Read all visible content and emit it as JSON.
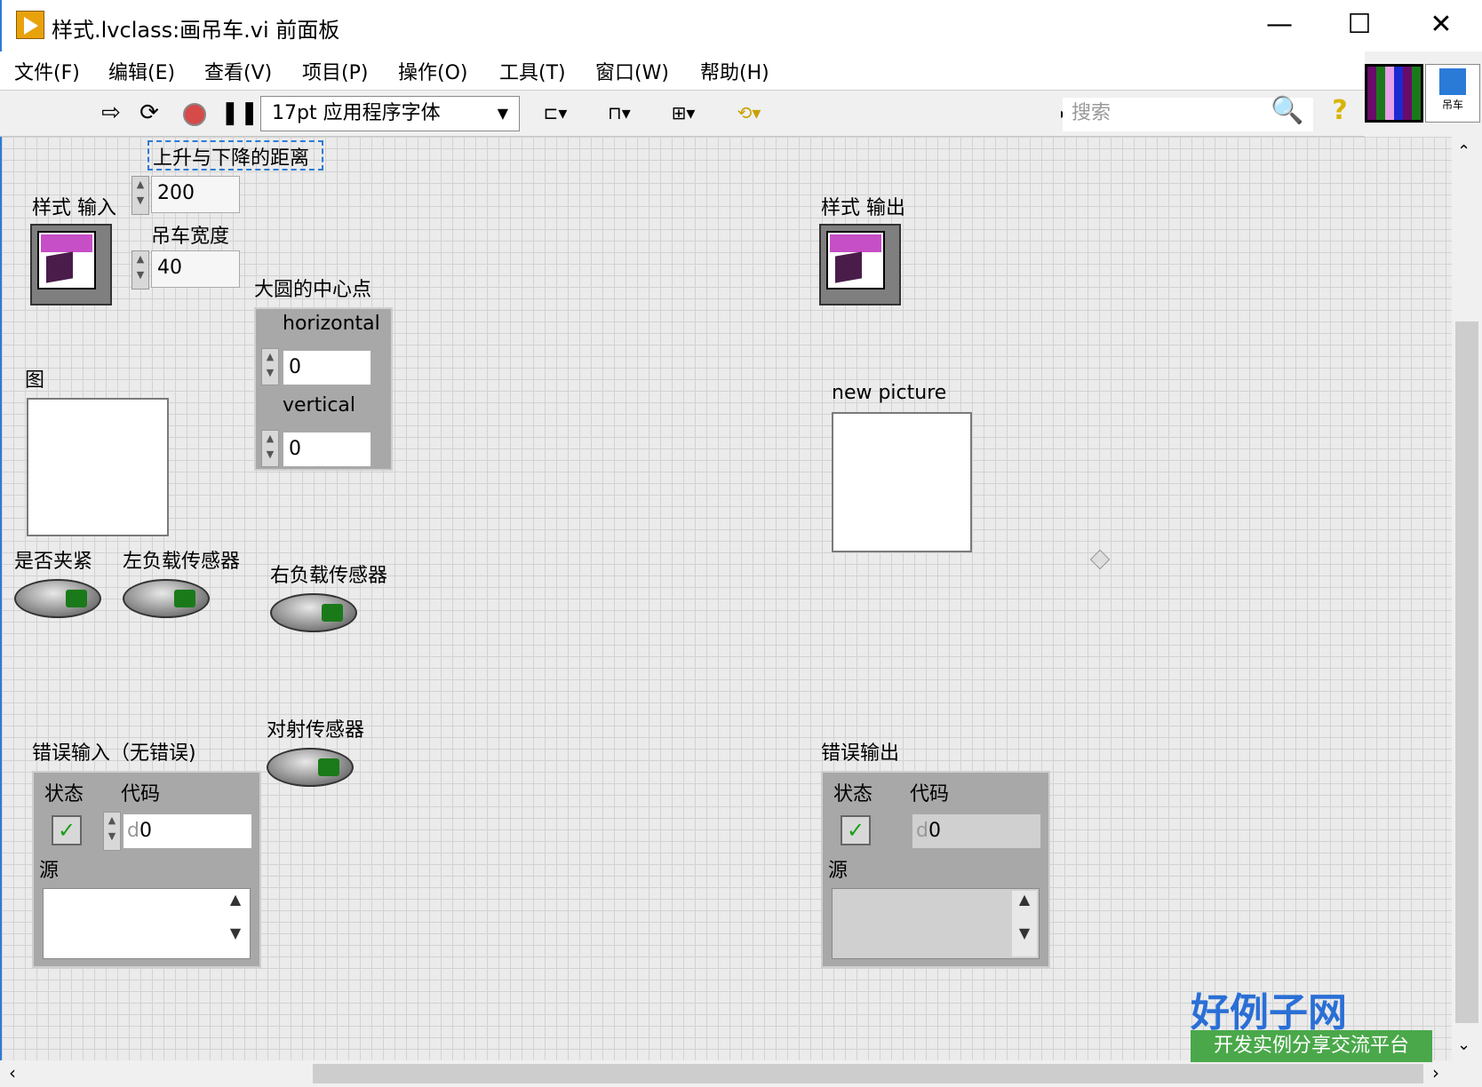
{
  "window": {
    "title": "样式.lvclass:画吊车.vi 前面板",
    "minimize": "—",
    "maximize": "☐",
    "close": "✕"
  },
  "menu": [
    "文件(F)",
    "编辑(E)",
    "查看(V)",
    "项目(P)",
    "操作(O)",
    "工具(T)",
    "窗口(W)",
    "帮助(H)"
  ],
  "toolbar": {
    "font": "17pt 应用程序字体",
    "search_placeholder": "搜索"
  },
  "icon_pane": {
    "label": "吊车"
  },
  "controls": {
    "style_in": {
      "label": "样式 输入"
    },
    "rise_fall": {
      "label": "上升与下降的距离",
      "value": "200"
    },
    "crane_width": {
      "label": "吊车宽度",
      "value": "40"
    },
    "big_circle": {
      "label": "大圆的中心点",
      "horizontal_label": "horizontal",
      "horizontal_value": "0",
      "vertical_label": "vertical",
      "vertical_value": "0"
    },
    "picture": {
      "label": "图"
    },
    "clamped": {
      "label": "是否夹紧"
    },
    "left_sensor": {
      "label": "左负载传感器"
    },
    "right_sensor": {
      "label": "右负载传感器"
    },
    "beam_sensor": {
      "label": "对射传感器"
    },
    "error_in": {
      "label": "错误输入（无错误)",
      "status_label": "状态",
      "code_label": "代码",
      "code_value": "0",
      "code_prefix": "d",
      "source_label": "源"
    }
  },
  "indicators": {
    "style_out": {
      "label": "样式 输出"
    },
    "new_picture": {
      "label": "new picture"
    },
    "error_out": {
      "label": "错误输出",
      "status_label": "状态",
      "code_label": "代码",
      "code_value": "0",
      "code_prefix": "d",
      "source_label": "源"
    }
  },
  "watermark": {
    "main": "好例子网",
    "sub": "开发实例分享交流平台"
  },
  "colors": {
    "accent": "#2b7bd6",
    "style_band": "#c64ec6",
    "led_green": "#1a7a1a"
  }
}
